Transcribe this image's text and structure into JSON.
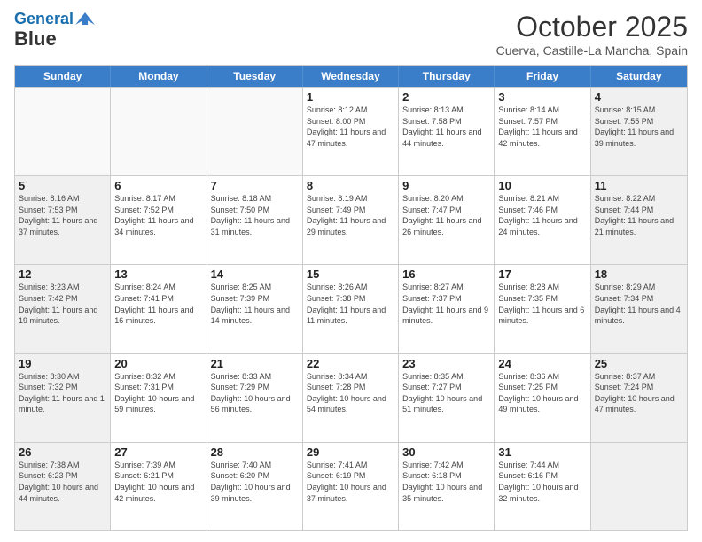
{
  "header": {
    "logo_line1": "General",
    "logo_line2": "Blue",
    "month": "October 2025",
    "location": "Cuerva, Castille-La Mancha, Spain"
  },
  "weekdays": [
    "Sunday",
    "Monday",
    "Tuesday",
    "Wednesday",
    "Thursday",
    "Friday",
    "Saturday"
  ],
  "rows": [
    [
      {
        "day": "",
        "info": "",
        "empty": true
      },
      {
        "day": "",
        "info": "",
        "empty": true
      },
      {
        "day": "",
        "info": "",
        "empty": true
      },
      {
        "day": "1",
        "info": "Sunrise: 8:12 AM\nSunset: 8:00 PM\nDaylight: 11 hours and 47 minutes."
      },
      {
        "day": "2",
        "info": "Sunrise: 8:13 AM\nSunset: 7:58 PM\nDaylight: 11 hours and 44 minutes."
      },
      {
        "day": "3",
        "info": "Sunrise: 8:14 AM\nSunset: 7:57 PM\nDaylight: 11 hours and 42 minutes."
      },
      {
        "day": "4",
        "info": "Sunrise: 8:15 AM\nSunset: 7:55 PM\nDaylight: 11 hours and 39 minutes.",
        "shaded": true
      }
    ],
    [
      {
        "day": "5",
        "info": "Sunrise: 8:16 AM\nSunset: 7:53 PM\nDaylight: 11 hours and 37 minutes.",
        "shaded": true
      },
      {
        "day": "6",
        "info": "Sunrise: 8:17 AM\nSunset: 7:52 PM\nDaylight: 11 hours and 34 minutes."
      },
      {
        "day": "7",
        "info": "Sunrise: 8:18 AM\nSunset: 7:50 PM\nDaylight: 11 hours and 31 minutes."
      },
      {
        "day": "8",
        "info": "Sunrise: 8:19 AM\nSunset: 7:49 PM\nDaylight: 11 hours and 29 minutes."
      },
      {
        "day": "9",
        "info": "Sunrise: 8:20 AM\nSunset: 7:47 PM\nDaylight: 11 hours and 26 minutes."
      },
      {
        "day": "10",
        "info": "Sunrise: 8:21 AM\nSunset: 7:46 PM\nDaylight: 11 hours and 24 minutes."
      },
      {
        "day": "11",
        "info": "Sunrise: 8:22 AM\nSunset: 7:44 PM\nDaylight: 11 hours and 21 minutes.",
        "shaded": true
      }
    ],
    [
      {
        "day": "12",
        "info": "Sunrise: 8:23 AM\nSunset: 7:42 PM\nDaylight: 11 hours and 19 minutes.",
        "shaded": true
      },
      {
        "day": "13",
        "info": "Sunrise: 8:24 AM\nSunset: 7:41 PM\nDaylight: 11 hours and 16 minutes."
      },
      {
        "day": "14",
        "info": "Sunrise: 8:25 AM\nSunset: 7:39 PM\nDaylight: 11 hours and 14 minutes."
      },
      {
        "day": "15",
        "info": "Sunrise: 8:26 AM\nSunset: 7:38 PM\nDaylight: 11 hours and 11 minutes."
      },
      {
        "day": "16",
        "info": "Sunrise: 8:27 AM\nSunset: 7:37 PM\nDaylight: 11 hours and 9 minutes."
      },
      {
        "day": "17",
        "info": "Sunrise: 8:28 AM\nSunset: 7:35 PM\nDaylight: 11 hours and 6 minutes."
      },
      {
        "day": "18",
        "info": "Sunrise: 8:29 AM\nSunset: 7:34 PM\nDaylight: 11 hours and 4 minutes.",
        "shaded": true
      }
    ],
    [
      {
        "day": "19",
        "info": "Sunrise: 8:30 AM\nSunset: 7:32 PM\nDaylight: 11 hours and 1 minute.",
        "shaded": true
      },
      {
        "day": "20",
        "info": "Sunrise: 8:32 AM\nSunset: 7:31 PM\nDaylight: 10 hours and 59 minutes."
      },
      {
        "day": "21",
        "info": "Sunrise: 8:33 AM\nSunset: 7:29 PM\nDaylight: 10 hours and 56 minutes."
      },
      {
        "day": "22",
        "info": "Sunrise: 8:34 AM\nSunset: 7:28 PM\nDaylight: 10 hours and 54 minutes."
      },
      {
        "day": "23",
        "info": "Sunrise: 8:35 AM\nSunset: 7:27 PM\nDaylight: 10 hours and 51 minutes."
      },
      {
        "day": "24",
        "info": "Sunrise: 8:36 AM\nSunset: 7:25 PM\nDaylight: 10 hours and 49 minutes."
      },
      {
        "day": "25",
        "info": "Sunrise: 8:37 AM\nSunset: 7:24 PM\nDaylight: 10 hours and 47 minutes.",
        "shaded": true
      }
    ],
    [
      {
        "day": "26",
        "info": "Sunrise: 7:38 AM\nSunset: 6:23 PM\nDaylight: 10 hours and 44 minutes.",
        "shaded": true
      },
      {
        "day": "27",
        "info": "Sunrise: 7:39 AM\nSunset: 6:21 PM\nDaylight: 10 hours and 42 minutes."
      },
      {
        "day": "28",
        "info": "Sunrise: 7:40 AM\nSunset: 6:20 PM\nDaylight: 10 hours and 39 minutes."
      },
      {
        "day": "29",
        "info": "Sunrise: 7:41 AM\nSunset: 6:19 PM\nDaylight: 10 hours and 37 minutes."
      },
      {
        "day": "30",
        "info": "Sunrise: 7:42 AM\nSunset: 6:18 PM\nDaylight: 10 hours and 35 minutes."
      },
      {
        "day": "31",
        "info": "Sunrise: 7:44 AM\nSunset: 6:16 PM\nDaylight: 10 hours and 32 minutes."
      },
      {
        "day": "",
        "info": "",
        "empty": true,
        "shaded": true
      }
    ]
  ]
}
